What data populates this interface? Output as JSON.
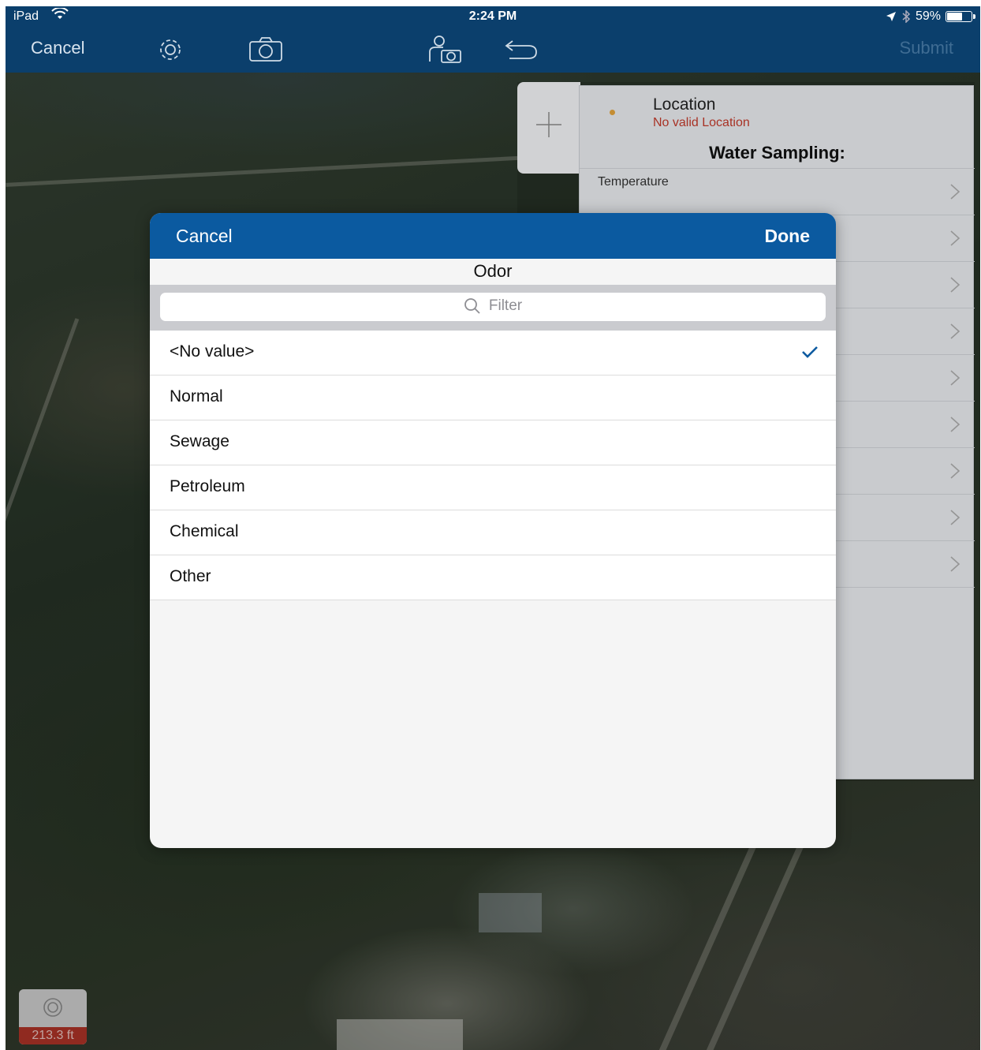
{
  "status_bar": {
    "carrier": "iPad",
    "time": "2:24 PM",
    "battery": "59%",
    "battery_level": 0.59
  },
  "nav": {
    "cancel": "Cancel",
    "submit": "Submit",
    "icons": [
      "gear-icon",
      "camera-icon",
      "person-camera-icon",
      "undo-icon"
    ]
  },
  "form": {
    "location_title": "Location",
    "location_status": "No valid Location",
    "heading": "Water Sampling:",
    "first_field": "Temperature",
    "row_count_visible": 9
  },
  "picker": {
    "cancel": "Cancel",
    "done": "Done",
    "title": "Odor",
    "filter_placeholder": "Filter",
    "options": [
      {
        "label": "<No value>",
        "selected": true
      },
      {
        "label": "Normal",
        "selected": false
      },
      {
        "label": "Sewage",
        "selected": false
      },
      {
        "label": "Petroleum",
        "selected": false
      },
      {
        "label": "Chemical",
        "selected": false
      },
      {
        "label": "Other",
        "selected": false
      }
    ]
  },
  "gps": {
    "accuracy": "213.3 ft"
  },
  "colors": {
    "nav_bar": "#0b3f6c",
    "picker_header": "#0b5aa0",
    "check": "#0b5aa0",
    "error_text": "#c0392b"
  }
}
